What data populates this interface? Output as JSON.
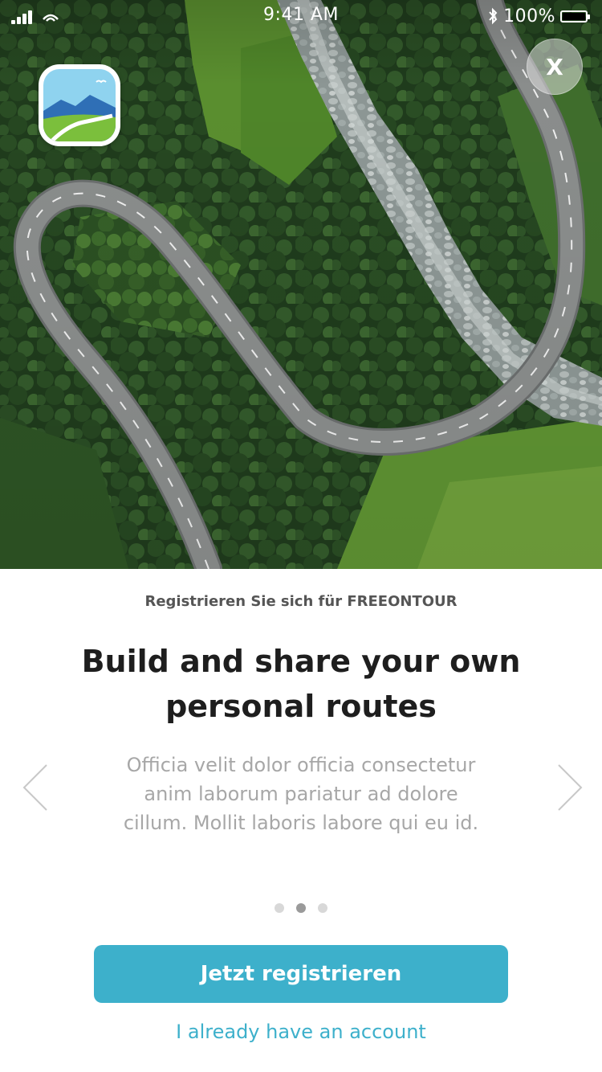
{
  "status_bar": {
    "time": "9:41 AM",
    "battery": "100%",
    "icons": [
      "signal-icon",
      "carrier-icon",
      "bluetooth-icon",
      "battery-icon"
    ]
  },
  "close_button": {
    "label": "X"
  },
  "app_logo": {
    "icon": "app-logo-icon"
  },
  "onboarding": {
    "subtitle": "Registrieren Sie sich für FREEONTOUR",
    "headline": "Build and share your own personal routes",
    "body": "Officia velit dolor officia consectetur anim laborum pariatur ad dolore cillum. Mollit laboris labore qui eu id.",
    "pagination": {
      "total": 3,
      "active_index": 1
    },
    "prev_icon": "chevron-left-icon",
    "next_icon": "chevron-right-icon"
  },
  "actions": {
    "register_label": "Jetzt registrieren",
    "login_label": "I already have an account"
  },
  "colors": {
    "accent": "#3db0cb",
    "headline": "#1e1e1e",
    "subtitle": "#555555",
    "body": "#a7a7a7",
    "dot_active": "#9a9a9a",
    "dot_inactive": "#d8d8d8"
  }
}
